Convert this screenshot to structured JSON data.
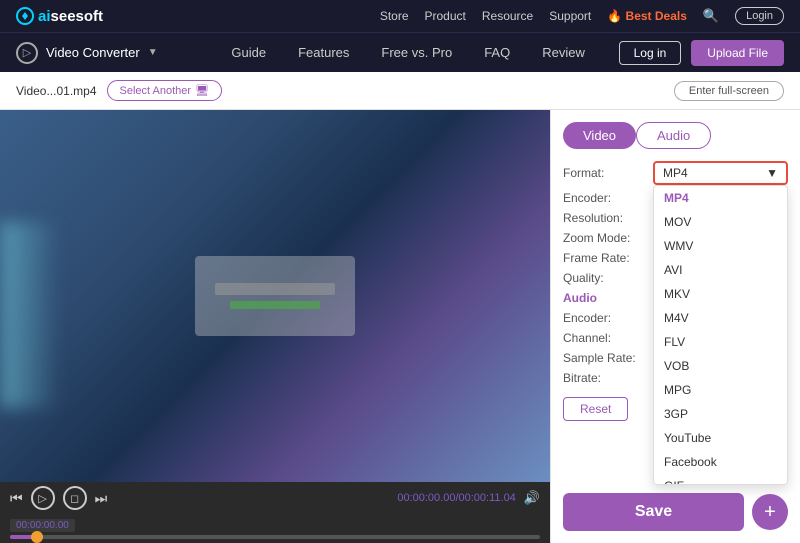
{
  "topNav": {
    "logoAi": "ai",
    "logoRest": "seesoft",
    "links": [
      "Store",
      "Product",
      "Resource",
      "Support",
      "Best Deals",
      "Login"
    ],
    "bestDeals": "Best Deals"
  },
  "secondNav": {
    "appIcon": "▷",
    "appTitle": "Video Converter",
    "links": [
      "Guide",
      "Features",
      "Free vs. Pro",
      "FAQ",
      "Review"
    ],
    "loginBtn": "Log in",
    "uploadBtn": "Upload File"
  },
  "toolbar": {
    "fileName": "Video...01.mp4",
    "selectAnotherLabel": "Select Another",
    "enterFullscreenLabel": "Enter full-screen"
  },
  "videoPlayer": {
    "timeDisplay": "00:00:00.00/00:00:11.04",
    "timeLabel": "00:00:00.00"
  },
  "settingsPanel": {
    "tabs": [
      {
        "label": "Video",
        "active": true
      },
      {
        "label": "Audio",
        "active": false
      }
    ],
    "videoFields": [
      {
        "label": "Format:"
      },
      {
        "label": "Encoder:"
      },
      {
        "label": "Resolution:"
      },
      {
        "label": "Zoom Mode:"
      },
      {
        "label": "Frame Rate:"
      },
      {
        "label": "Quality:"
      }
    ],
    "audioSection": "Audio",
    "audioFields": [
      {
        "label": "Encoder:"
      },
      {
        "label": "Channel:"
      },
      {
        "label": "Sample Rate:"
      },
      {
        "label": "Bitrate:"
      }
    ],
    "formatValue": "MP4",
    "formatOptions": [
      "MP4",
      "MOV",
      "WMV",
      "AVI",
      "MKV",
      "M4V",
      "FLV",
      "VOB",
      "MPG",
      "3GP",
      "YouTube",
      "Facebook",
      "GIF"
    ],
    "resetLabel": "Reset",
    "saveLabel": "Save",
    "savePlusLabel": "+"
  }
}
